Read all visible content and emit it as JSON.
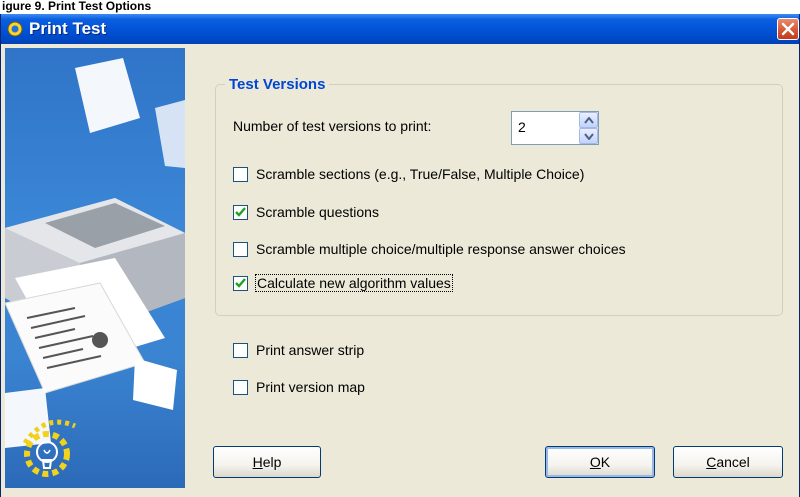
{
  "caption": "igure 9. Print Test Options",
  "window": {
    "title": "Print Test"
  },
  "group": {
    "legend": "Test Versions",
    "versions_label": "Number of test versions to print:",
    "versions_value": "2"
  },
  "options": [
    {
      "label": "Scramble sections (e.g., True/False, Multiple Choice)",
      "checked": false
    },
    {
      "label": "Scramble questions",
      "checked": true
    },
    {
      "label": "Scramble multiple choice/multiple response answer choices",
      "checked": false
    },
    {
      "label": "Calculate new algorithm values",
      "checked": true
    }
  ],
  "extras": [
    {
      "label": "Print answer strip",
      "checked": false
    },
    {
      "label": "Print version map",
      "checked": false
    }
  ],
  "buttons": {
    "help_mn": "H",
    "help_rest": "elp",
    "ok_mn": "O",
    "ok_rest": "K",
    "cancel_mn": "C",
    "cancel_rest": "ancel"
  },
  "colors": {
    "title_bar": "#0254d6",
    "legend_text": "#0046d5",
    "dialog_bg": "#ece9d8",
    "check_mark": "#21a121"
  }
}
